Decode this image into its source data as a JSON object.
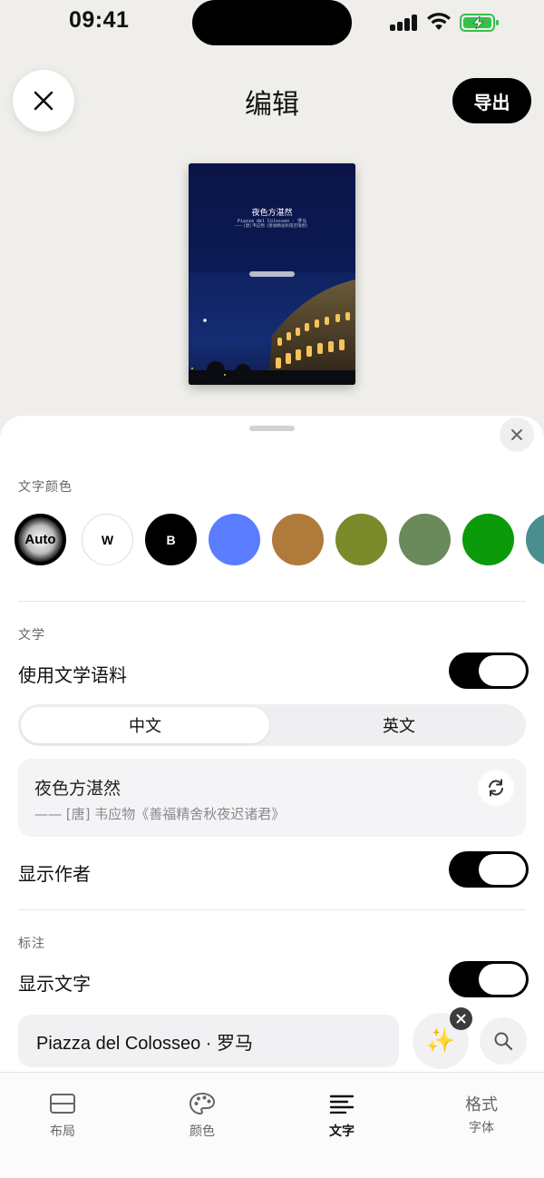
{
  "status_bar": {
    "time": "09:41"
  },
  "header": {
    "title": "编辑",
    "export_label": "导出"
  },
  "preview": {
    "title": "夜色方湛然",
    "subtitle": "Piazza del Colosseo · 罗马",
    "source": "—— [唐] 韦应物《善福精舍秋夜迟诸君》"
  },
  "text_color": {
    "section_label": "文字颜色",
    "swatches": [
      {
        "label": "Auto",
        "color": "#000000"
      },
      {
        "label": "W",
        "color": "#ffffff"
      },
      {
        "label": "B",
        "color": "#000000"
      },
      {
        "label": "",
        "color": "#5a7cff"
      },
      {
        "label": "",
        "color": "#b07a3a"
      },
      {
        "label": "",
        "color": "#7b8a2a"
      },
      {
        "label": "",
        "color": "#6a8a5c"
      },
      {
        "label": "",
        "color": "#0a9a0a"
      },
      {
        "label": "",
        "color": "#4a8f8f"
      }
    ]
  },
  "literature": {
    "section_label": "文学",
    "use_corpus_label": "使用文学语料",
    "use_corpus_on": true,
    "tabs": [
      {
        "label": "中文",
        "active": true
      },
      {
        "label": "英文",
        "active": false
      }
    ],
    "quote_title": "夜色方湛然",
    "quote_source": "—— [唐] 韦应物《善福精舍秋夜迟诸君》",
    "show_author_label": "显示作者",
    "show_author_on": true
  },
  "caption": {
    "section_label": "标注",
    "show_text_label": "显示文字",
    "show_text_on": true,
    "input_value": "Piazza del Colosseo · 罗马",
    "magic_icon": "✨"
  },
  "tabbar": {
    "tabs": [
      {
        "label": "布局",
        "icon": "layout-icon",
        "active": false
      },
      {
        "label": "颜色",
        "icon": "palette-icon",
        "active": false
      },
      {
        "label": "文字",
        "icon": "text-lines-icon",
        "active": true
      },
      {
        "label": "字体",
        "icon_text": "格式",
        "active": false
      }
    ]
  }
}
